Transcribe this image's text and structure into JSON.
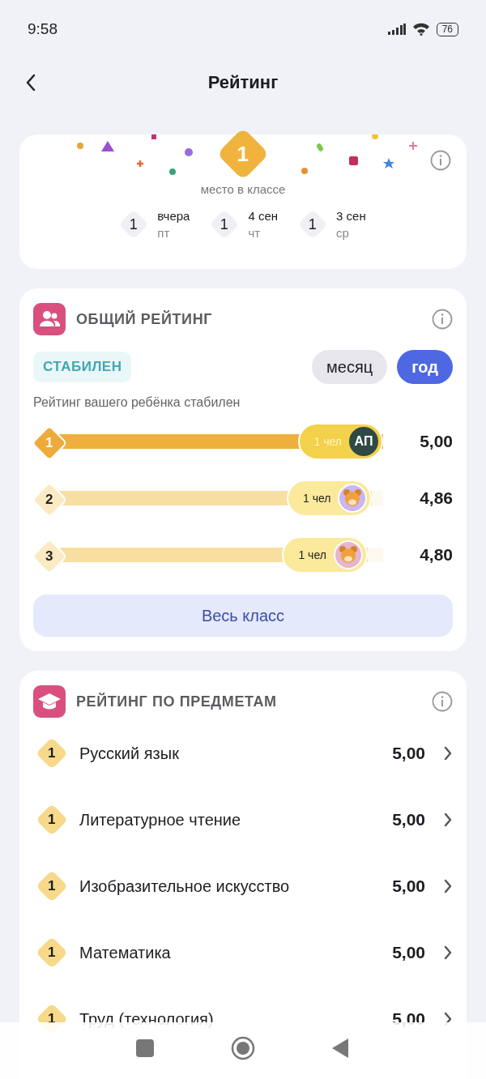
{
  "status_bar": {
    "time": "9:58",
    "battery": "76"
  },
  "header": {
    "title": "Рейтинг"
  },
  "place": {
    "rank": "1",
    "caption": "место в классе",
    "history": [
      {
        "rank": "1",
        "label": "вчера",
        "weekday": "пт"
      },
      {
        "rank": "1",
        "label": "4 сен",
        "weekday": "чт"
      },
      {
        "rank": "1",
        "label": "3 сен",
        "weekday": "ср"
      }
    ]
  },
  "overall": {
    "title": "ОБЩИЙ РЕЙТИНГ",
    "trend": "СТАБИЛЕН",
    "periods": [
      {
        "label": "месяц",
        "selected": false
      },
      {
        "label": "год",
        "selected": true
      }
    ],
    "description": "Рейтинг вашего ребёнка стабилен",
    "ranks": [
      {
        "rank": "1",
        "current": true,
        "level": 1.0,
        "count": "1 чел",
        "avatar": {
          "kind": "initials",
          "text": "АП",
          "color": "#2f4a45"
        },
        "score": "5,00"
      },
      {
        "rank": "2",
        "current": false,
        "level": 0.968,
        "count": "1 чел",
        "avatar": {
          "kind": "animal",
          "color": "#c9b6f2"
        },
        "score": "4,86"
      },
      {
        "rank": "3",
        "current": false,
        "level": 0.955,
        "count": "1 чел",
        "avatar": {
          "kind": "animal",
          "color": "#e8b4cf"
        },
        "score": "4,80"
      }
    ],
    "button": "Весь класс"
  },
  "subjects": {
    "title": "РЕЙТИНГ ПО ПРЕДМЕТАМ",
    "items": [
      {
        "rank": "1",
        "name": "Русский язык",
        "score": "5,00"
      },
      {
        "rank": "1",
        "name": "Литературное чтение",
        "score": "5,00"
      },
      {
        "rank": "1",
        "name": "Изобразительное искусство",
        "score": "5,00"
      },
      {
        "rank": "1",
        "name": "Математика",
        "score": "5,00"
      },
      {
        "rank": "1",
        "name": "Труд (технология)",
        "score": "5,00"
      }
    ]
  }
}
